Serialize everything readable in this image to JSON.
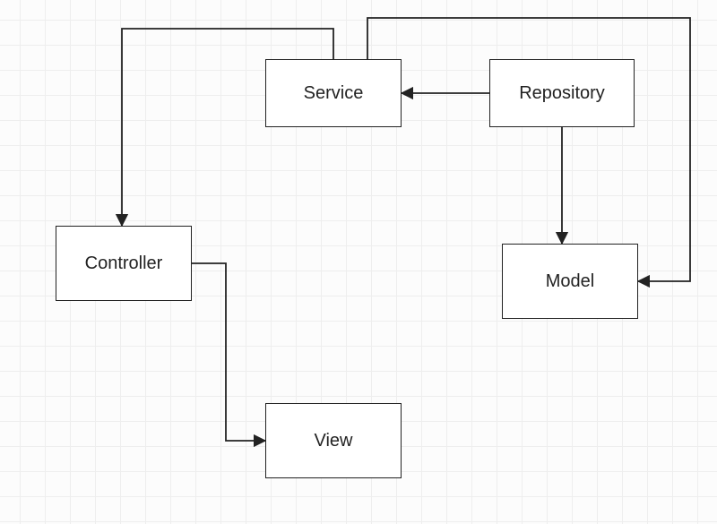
{
  "nodes": {
    "service": {
      "label": "Service"
    },
    "repository": {
      "label": "Repository"
    },
    "controller": {
      "label": "Controller"
    },
    "model": {
      "label": "Model"
    },
    "view": {
      "label": "View"
    }
  },
  "edges": [
    {
      "from": "repository",
      "to": "service"
    },
    {
      "from": "repository",
      "to": "model"
    },
    {
      "from": "service",
      "to": "controller"
    },
    {
      "from": "service",
      "to": "model"
    },
    {
      "from": "controller",
      "to": "view"
    }
  ]
}
